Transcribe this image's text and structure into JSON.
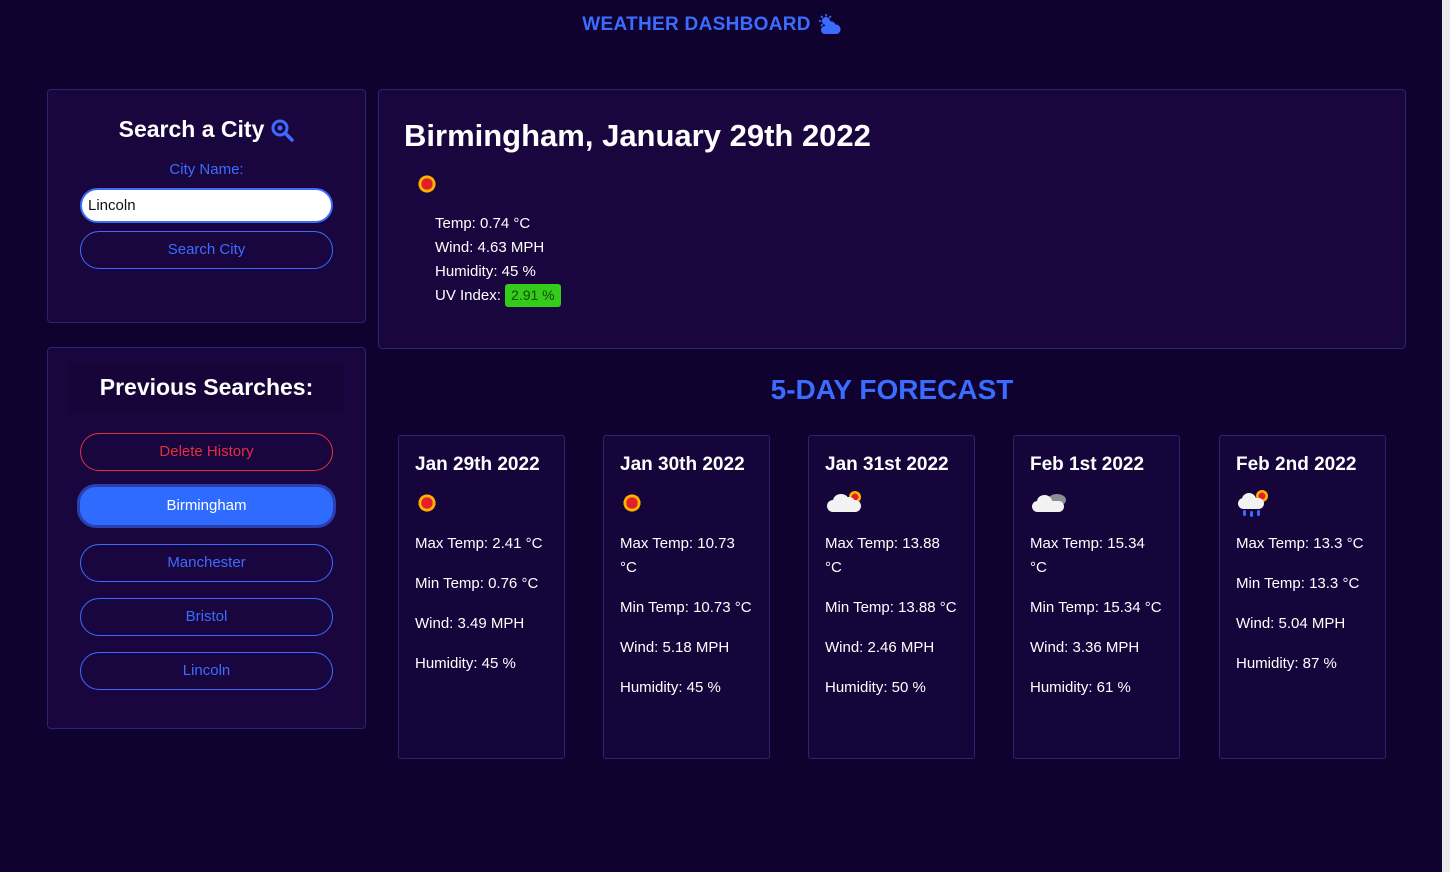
{
  "header": {
    "title": "WEATHER DASHBOARD"
  },
  "search": {
    "heading": "Search a City",
    "label": "City Name:",
    "input_value": "Lincoln",
    "button_label": "Search City"
  },
  "history": {
    "heading": "Previous Searches:",
    "delete_label": "Delete History",
    "items": [
      {
        "label": "Birmingham",
        "active": true
      },
      {
        "label": "Manchester",
        "active": false
      },
      {
        "label": "Bristol",
        "active": false
      },
      {
        "label": "Lincoln",
        "active": false
      }
    ]
  },
  "current": {
    "title": "Birmingham, January 29th 2022",
    "icon": "sun-icon",
    "temp": "Temp: 0.74 °C",
    "wind": "Wind: 4.63 MPH",
    "humidity": "Humidity: 45 %",
    "uv_label": "UV Index:",
    "uv_value": "2.91 %",
    "uv_color": "#33cc1a"
  },
  "forecast": {
    "heading": "5-DAY FORECAST",
    "days": [
      {
        "date": "Jan 29th 2022",
        "icon": "sun-icon",
        "max": "Max Temp: 2.41 °C",
        "min": "Min Temp: 0.76 °C",
        "wind": "Wind: 3.49 MPH",
        "humidity": "Humidity: 45 %"
      },
      {
        "date": "Jan 30th 2022",
        "icon": "sun-icon",
        "max": "Max Temp: 10.73 °C",
        "min": "Min Temp: 10.73 °C",
        "wind": "Wind: 5.18 MPH",
        "humidity": "Humidity: 45 %"
      },
      {
        "date": "Jan 31st 2022",
        "icon": "sun-behind-cloud-icon",
        "max": "Max Temp: 13.88 °C",
        "min": "Min Temp: 13.88 °C",
        "wind": "Wind: 2.46 MPH",
        "humidity": "Humidity: 50 %"
      },
      {
        "date": "Feb 1st 2022",
        "icon": "cloudy-icon",
        "max": "Max Temp: 15.34 °C",
        "min": "Min Temp: 15.34 °C",
        "wind": "Wind: 3.36 MPH",
        "humidity": "Humidity: 61 %"
      },
      {
        "date": "Feb 2nd 2022",
        "icon": "rain-sun-cloud-icon",
        "max": "Max Temp: 13.3 °C",
        "min": "Min Temp: 13.3 °C",
        "wind": "Wind: 5.04 MPH",
        "humidity": "Humidity: 87 %"
      }
    ]
  }
}
